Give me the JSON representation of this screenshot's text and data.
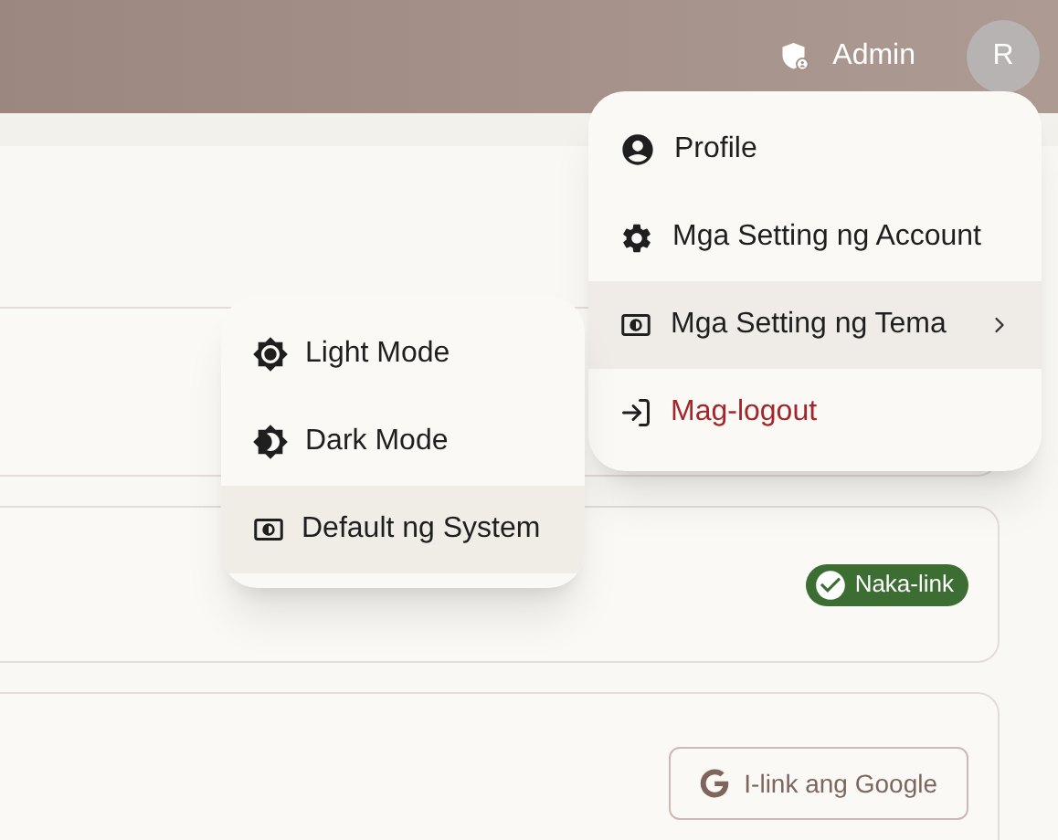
{
  "header": {
    "role_label": "Admin",
    "avatar_initial": "R"
  },
  "cards": [
    {
      "kind": "plain"
    },
    {
      "kind": "status",
      "badge": "Naka-link"
    },
    {
      "kind": "action",
      "button": "I-link ang Google"
    }
  ],
  "user_menu": {
    "items": [
      {
        "kind": "profile",
        "label": "Profile",
        "expanded": false
      },
      {
        "kind": "settings",
        "label": "Mga Setting ng Account",
        "expanded": false
      },
      {
        "kind": "theme",
        "label": "Mga Setting ng Tema",
        "expanded": true
      },
      {
        "kind": "logout",
        "label": "Mag-logout",
        "expanded": false
      }
    ]
  },
  "theme_menu": {
    "items": [
      {
        "kind": "light",
        "label": "Light Mode",
        "selected": false
      },
      {
        "kind": "dark",
        "label": "Dark Mode",
        "selected": false
      },
      {
        "kind": "system",
        "label": "Default ng System",
        "selected": true
      }
    ]
  }
}
